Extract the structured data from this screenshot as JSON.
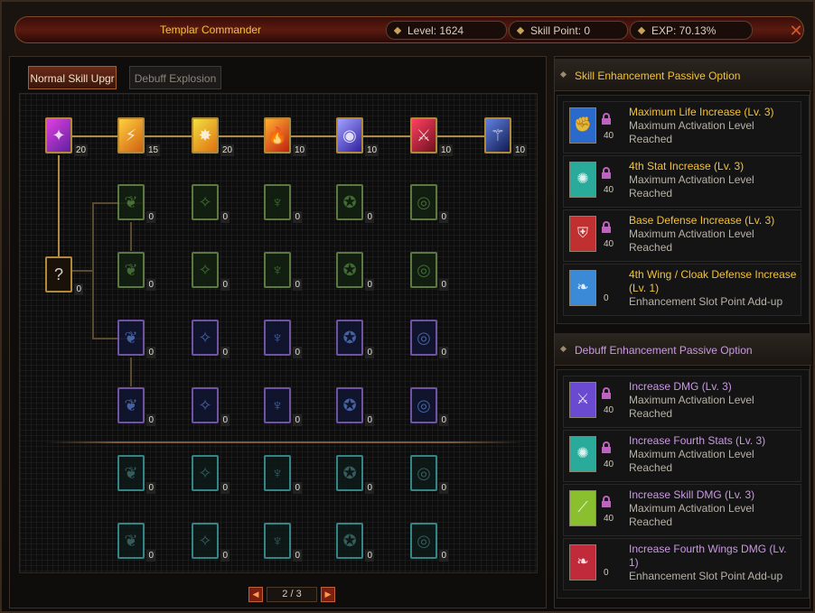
{
  "header": {
    "title": "Templar Commander",
    "level": "Level: 1624",
    "skill_point": "Skill Point: 0",
    "exp": "EXP:  70.13%"
  },
  "tabs": [
    {
      "label": "Normal Skill Upgr"
    },
    {
      "label": "Debuff Explosion"
    }
  ],
  "tree": {
    "top_levels": [
      "20",
      "15",
      "20",
      "10",
      "10",
      "10",
      "10"
    ],
    "root_level": "0",
    "zero": "0"
  },
  "pager": {
    "prev": "◀",
    "page": "2 / 3",
    "next": "▶"
  },
  "skill_section": {
    "title": "Skill Enhancement Passive Option",
    "options": [
      {
        "name": "Maximum Life Increase (Lv. 3)",
        "desc": "Maximum Activation Level Reached",
        "level": "40",
        "icon": "arm-icon",
        "color": "#2a6acc"
      },
      {
        "name": "4th Stat Increase (Lv. 3)",
        "desc": "Maximum Activation Level Reached",
        "level": "40",
        "icon": "stat-icon",
        "color": "#2aaa9a"
      },
      {
        "name": "Base Defense Increase (Lv. 3)",
        "desc": "Maximum Activation Level Reached",
        "level": "40",
        "icon": "shield-icon",
        "color": "#c03030"
      },
      {
        "name": "4th Wing / Cloak Defense Increase (Lv. 1)",
        "desc": "Enhancement Slot Point Add-up",
        "level": "0",
        "icon": "wing-icon",
        "color": "#3a8ad8"
      }
    ]
  },
  "debuff_section": {
    "title": "Debuff Enhancement Passive Option",
    "options": [
      {
        "name": "Increase DMG (Lv. 3)",
        "desc": "Maximum Activation Level Reached",
        "level": "40",
        "icon": "sword-icon",
        "color": "#6a4ad0"
      },
      {
        "name": "Increase Fourth Stats (Lv. 3)",
        "desc": "Maximum Activation Level Reached",
        "level": "40",
        "icon": "stat-icon",
        "color": "#2aaa9a"
      },
      {
        "name": "Increase Skill DMG (Lv. 3)",
        "desc": "Maximum Activation Level Reached",
        "level": "40",
        "icon": "blade-icon",
        "color": "#8ac030"
      },
      {
        "name": "Increase Fourth Wings DMG (Lv. 1)",
        "desc": "Enhancement Slot Point Add-up",
        "level": "0",
        "icon": "wing-icon",
        "color": "#c02a3a"
      }
    ]
  },
  "colors": {
    "accent_gold": "#f2c23a",
    "accent_violet": "#c89ae0",
    "frame_red": "#5a1a10"
  }
}
